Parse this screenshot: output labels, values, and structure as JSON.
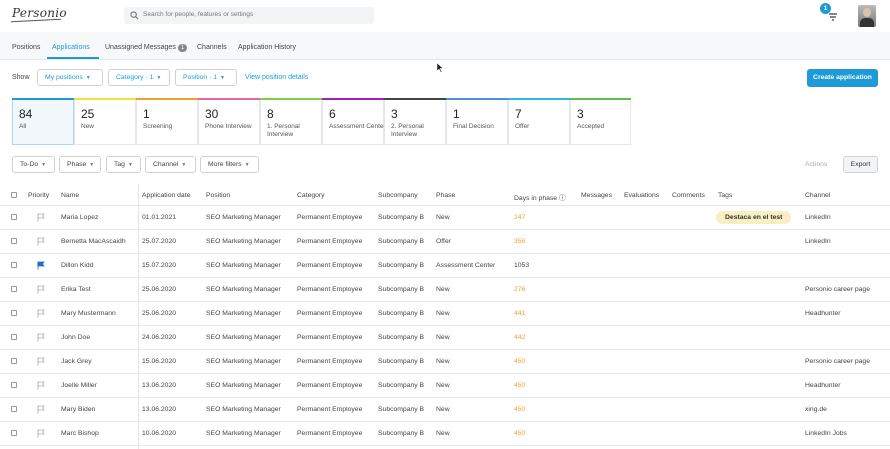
{
  "app": {
    "logo_text": "Personio"
  },
  "search": {
    "placeholder": "Search for people, features or settings"
  },
  "notifications": {
    "count": "1"
  },
  "tabs": [
    {
      "label": "Positions",
      "active": false
    },
    {
      "label": "Applications",
      "active": true
    },
    {
      "label": "Unassigned Messages",
      "badge": "1",
      "active": false
    },
    {
      "label": "Channels",
      "active": false
    },
    {
      "label": "Application History",
      "active": false
    }
  ],
  "filters": {
    "show_label": "Show",
    "my_positions": "My positions",
    "category": "Category · 1",
    "position": "Position · 1",
    "view_position_details": "View position details",
    "create_application": "Create application"
  },
  "phases": [
    {
      "count": "84",
      "label": "All",
      "color": "#1e9bd7"
    },
    {
      "count": "25",
      "label": "New",
      "color": "#f0e040"
    },
    {
      "count": "1",
      "label": "Screening",
      "color": "#f0a030"
    },
    {
      "count": "30",
      "label": "Phone Interview",
      "color": "#e06aa0"
    },
    {
      "count": "8",
      "label": "1. Personal Interview",
      "color": "#7ccf4a"
    },
    {
      "count": "6",
      "label": "Assessment Center",
      "color": "#a020c0"
    },
    {
      "count": "3",
      "label": "2. Personal Interview",
      "color": "#444444"
    },
    {
      "count": "1",
      "label": "Final Decision",
      "color": "#4a8fe0"
    },
    {
      "count": "7",
      "label": "Offer",
      "color": "#2fb7e8"
    },
    {
      "count": "3",
      "label": "Accepted",
      "color": "#5cc04a"
    }
  ],
  "toolbar": {
    "todo": "To-Do",
    "phase": "Phase",
    "tag": "Tag",
    "channel": "Channel",
    "more_filters": "More filters",
    "actions": "Actions",
    "export": "Export"
  },
  "table": {
    "headers": {
      "priority": "Priority",
      "name": "Name",
      "application_date": "Application date",
      "position": "Position",
      "category": "Category",
      "subcompany": "Subcompany",
      "phase": "Phase",
      "days_in_phase": "Days in phase ⓘ",
      "messages": "Messages",
      "evaluations": "Evaluations",
      "comments": "Comments",
      "tags": "Tags",
      "channel": "Channel"
    },
    "rows": [
      {
        "name": "Maria Lopez",
        "date": "01.01.2021",
        "position": "SEO Marketing Manager",
        "category": "Permanent Employee",
        "subcompany": "Subcompany B",
        "phase": "New",
        "days": "247",
        "tag": "Destaca en el test",
        "channel": "LinkedIn",
        "flagged": false
      },
      {
        "name": "Bernetta MacAscaidh",
        "date": "25.07.2020",
        "position": "SEO Marketing Manager",
        "category": "Permanent Employee",
        "subcompany": "Subcompany B",
        "phase": "Offer",
        "days": "356",
        "tag": "",
        "channel": "LinkedIn",
        "flagged": false
      },
      {
        "name": "Dillon Kidd",
        "date": "15.07.2020",
        "position": "SEO Marketing Manager",
        "category": "Permanent Employee",
        "subcompany": "Subcompany B",
        "phase": "Assessment Center",
        "days": "1053",
        "tag": "",
        "channel": "",
        "flagged": true
      },
      {
        "name": "Erika Test",
        "date": "25.06.2020",
        "position": "SEO Marketing Manager",
        "category": "Permanent Employee",
        "subcompany": "Subcompany B",
        "phase": "New",
        "days": "276",
        "tag": "",
        "channel": "Personio career page",
        "flagged": false
      },
      {
        "name": "Mary Mustermann",
        "date": "25.06.2020",
        "position": "SEO Marketing Manager",
        "category": "Permanent Employee",
        "subcompany": "Subcompany B",
        "phase": "New",
        "days": "441",
        "tag": "",
        "channel": "Headhunter",
        "flagged": false
      },
      {
        "name": "John Doe",
        "date": "24.06.2020",
        "position": "SEO Marketing Manager",
        "category": "Permanent Employee",
        "subcompany": "Subcompany B",
        "phase": "New",
        "days": "442",
        "tag": "",
        "channel": "",
        "flagged": false
      },
      {
        "name": "Jack Grey",
        "date": "15.06.2020",
        "position": "SEO Marketing Manager",
        "category": "Permanent Employee",
        "subcompany": "Subcompany B",
        "phase": "New",
        "days": "450",
        "tag": "",
        "channel": "Personio career page",
        "flagged": false
      },
      {
        "name": "Joelle Miller",
        "date": "13.06.2020",
        "position": "SEO Marketing Manager",
        "category": "Permanent Employee",
        "subcompany": "Subcompany B",
        "phase": "New",
        "days": "450",
        "tag": "",
        "channel": "Headhunter",
        "flagged": false
      },
      {
        "name": "Mary Biden",
        "date": "13.06.2020",
        "position": "SEO Marketing Manager",
        "category": "Permanent Employee",
        "subcompany": "Subcompany B",
        "phase": "New",
        "days": "450",
        "tag": "",
        "channel": "xing.de",
        "flagged": false
      },
      {
        "name": "Marc Bishop",
        "date": "10.06.2020",
        "position": "SEO Marketing Manager",
        "category": "Permanent Employee",
        "subcompany": "Subcompany B",
        "phase": "New",
        "days": "450",
        "tag": "",
        "channel": "LinkedIn Jobs",
        "flagged": false
      }
    ]
  }
}
